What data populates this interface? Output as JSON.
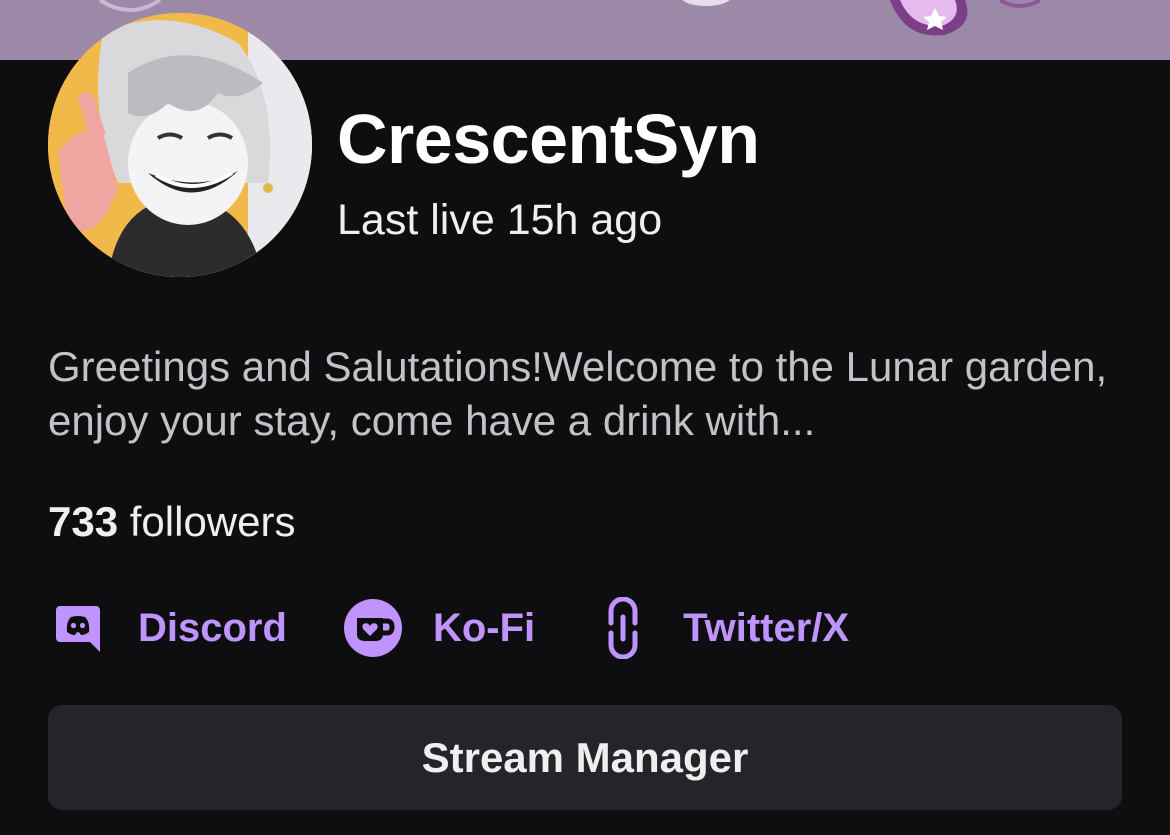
{
  "banner": {
    "color": "#9c89a7"
  },
  "channel": {
    "name": "CrescentSyn",
    "last_live": "Last live 15h ago",
    "bio": "Greetings and Salutations!Welcome to the Lunar garden, enjoy your stay, come have a drink with...",
    "followers_count": "733",
    "followers_label": "followers"
  },
  "links": [
    {
      "label": "Discord",
      "icon": "discord-icon"
    },
    {
      "label": "Ko-Fi",
      "icon": "kofi-icon"
    },
    {
      "label": "Twitter/X",
      "icon": "link-icon"
    }
  ],
  "actions": {
    "stream_manager_label": "Stream Manager"
  },
  "colors": {
    "background": "#0e0e10",
    "accent": "#bf94ff",
    "button_bg": "#252428"
  }
}
